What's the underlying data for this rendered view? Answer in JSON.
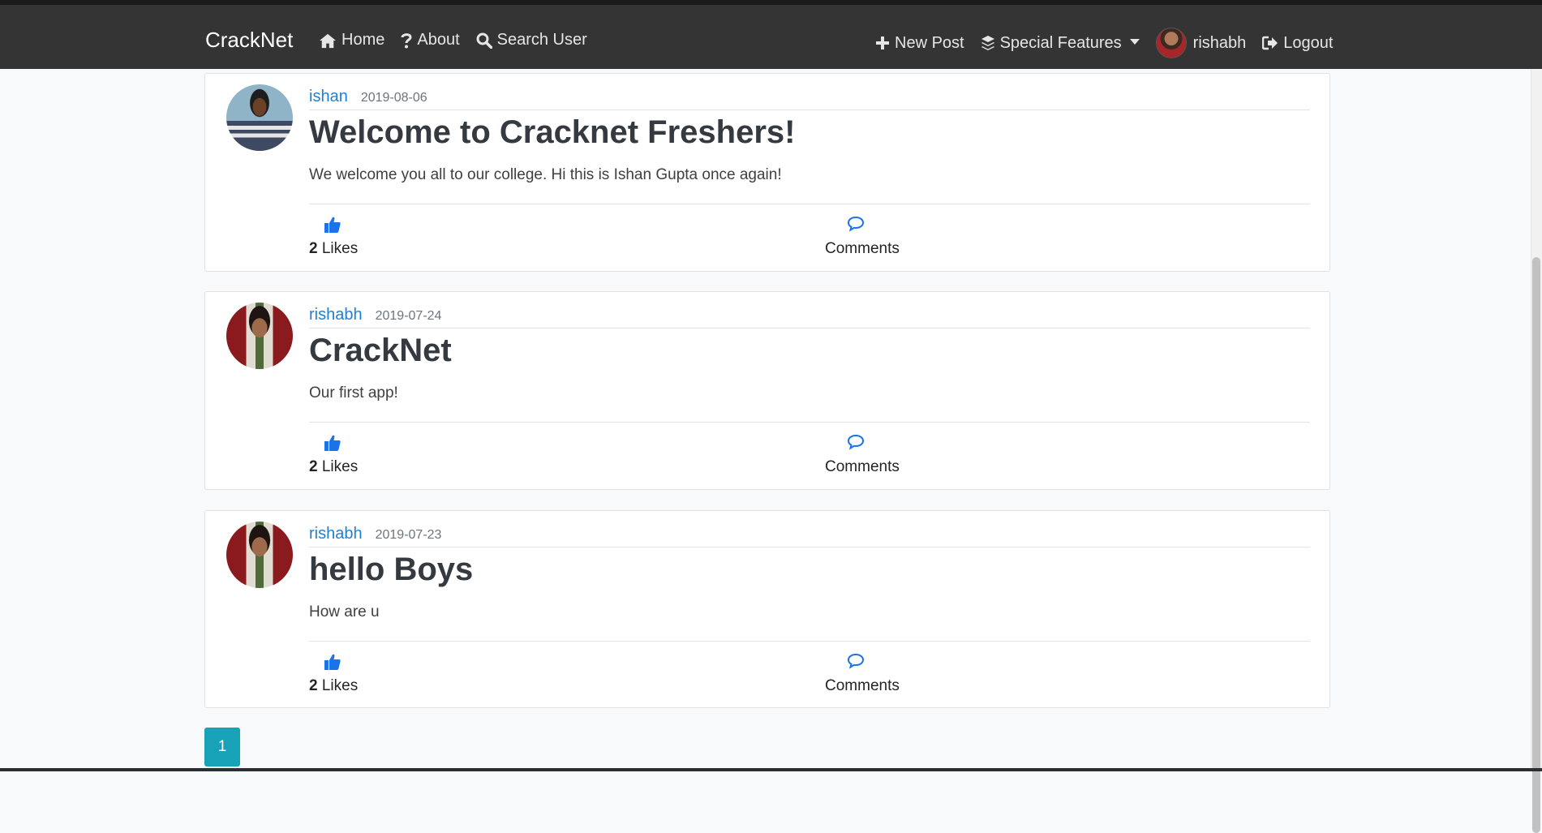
{
  "navbar": {
    "brand": "CrackNet",
    "left_items": [
      {
        "label": "Home",
        "icon": "home-icon"
      },
      {
        "label": "About",
        "icon": "question-icon"
      },
      {
        "label": "Search User",
        "icon": "search-icon"
      }
    ],
    "right_items": [
      {
        "label": "New Post",
        "icon": "plus-icon"
      },
      {
        "label": "Special Features",
        "icon": "layers-icon"
      },
      {
        "label": "rishabh",
        "icon": "avatar"
      },
      {
        "label": "Logout",
        "icon": "logout-icon"
      }
    ]
  },
  "posts": [
    {
      "author": "ishan",
      "date": "2019-08-06",
      "title": "Welcome to Cracknet Freshers!",
      "content": "We welcome you all to our college. Hi this is Ishan Gupta once again!",
      "likes_count": "2",
      "likes_label": "Likes",
      "comments_label": "Comments"
    },
    {
      "author": "rishabh",
      "date": "2019-07-24",
      "title": "CrackNet",
      "content": "Our first app!",
      "likes_count": "2",
      "likes_label": "Likes",
      "comments_label": "Comments"
    },
    {
      "author": "rishabh",
      "date": "2019-07-23",
      "title": "hello Boys",
      "content": "How are u",
      "likes_count": "2",
      "likes_label": "Likes",
      "comments_label": "Comments"
    }
  ],
  "pagination": {
    "current_page": "1"
  },
  "colors": {
    "navbar_bg": "#343434",
    "link": "#1e7fd6",
    "icon_blue": "#1a73e8",
    "page_active": "#17a2b8"
  }
}
